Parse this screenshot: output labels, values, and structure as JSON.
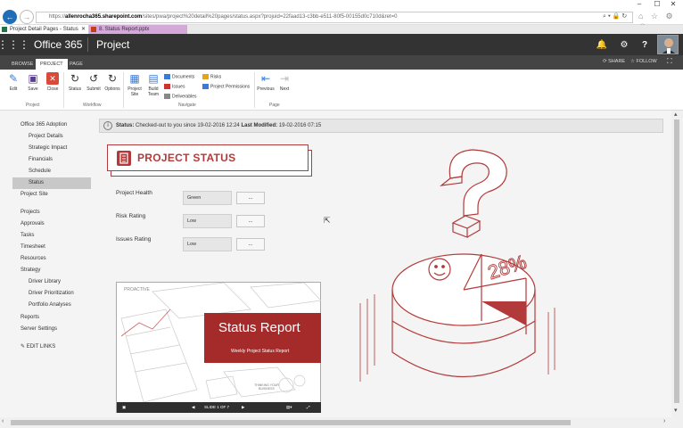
{
  "window": {
    "minimize": "–",
    "maximize": "☐",
    "close": "✕"
  },
  "browser": {
    "url_prefix": "https://",
    "url_domain": "allenrocha365.sharepoint.com",
    "url_rest": "/sites/pwa/project%20detail%20pages/status.aspx?projuid=22faad13-c3bb-e511-80f5-00155d0c710d&ret=0",
    "url_controls": "⌕ ▾ 🔒 ↻",
    "toolbar_icons": "⌂ ☆ ⚙ ☺",
    "tabs": [
      {
        "label": "Project Detail Pages - Status",
        "close": "✕"
      },
      {
        "label": "8. Status Report.pptx"
      }
    ]
  },
  "suite": {
    "app_name": "Office 365",
    "site_name": "Project",
    "bell_icon": "🔔",
    "gear_icon": "⚙",
    "help_icon": "?"
  },
  "ribbon": {
    "tabs": [
      "BROWSE",
      "PROJECT",
      "PAGE"
    ],
    "share": "SHARE",
    "follow": "FOLLOW",
    "buttons": {
      "edit": "Edit",
      "save": "Save",
      "close": "Close",
      "status": "Status",
      "submit": "Submit",
      "options": "Options",
      "project_site": "Project Site",
      "build_team": "Build Team",
      "documents": "Documents",
      "issues": "Issues",
      "deliverables": "Deliverables",
      "risks": "Risks",
      "project_permissions": "Project Permissions",
      "previous": "Previous",
      "next": "Next"
    },
    "groups": {
      "project": "Project",
      "workflow": "Workflow",
      "navigate": "Navigate",
      "page": "Page"
    }
  },
  "leftnav": {
    "items": [
      {
        "label": "Office 365 Adoption",
        "level": "top"
      },
      {
        "label": "Project Details",
        "level": "sub"
      },
      {
        "label": "Strategic Impact",
        "level": "sub"
      },
      {
        "label": "Financials",
        "level": "sub"
      },
      {
        "label": "Schedule",
        "level": "sub"
      },
      {
        "label": "Status",
        "level": "sub",
        "selected": true
      },
      {
        "label": "Project Site",
        "level": "top"
      },
      {
        "label": "Projects",
        "level": "top"
      },
      {
        "label": "Approvals",
        "level": "top"
      },
      {
        "label": "Tasks",
        "level": "top"
      },
      {
        "label": "Timesheet",
        "level": "top"
      },
      {
        "label": "Resources",
        "level": "top"
      },
      {
        "label": "Strategy",
        "level": "top"
      },
      {
        "label": "Driver Library",
        "level": "sub"
      },
      {
        "label": "Driver Prioritization",
        "level": "sub"
      },
      {
        "label": "Portfolio Analyses",
        "level": "sub"
      },
      {
        "label": "Reports",
        "level": "top"
      },
      {
        "label": "Server Settings",
        "level": "top"
      }
    ],
    "edit_links": "EDIT LINKS"
  },
  "status_bar": {
    "label": "Status:",
    "text": " Checked-out to you since 19-02-2016 12:24 ",
    "modified_label": "Last Modified:",
    "modified_value": " 19-02-2016 07:15"
  },
  "banner": {
    "title": "PROJECT STATUS"
  },
  "fields": [
    {
      "label": "Project Health",
      "value": "Green",
      "button": "..."
    },
    {
      "label": "Risk Rating",
      "value": "Low",
      "button": "..."
    },
    {
      "label": "Issues Rating",
      "value": "Low",
      "button": "..."
    }
  ],
  "slide": {
    "brand": "PROACTIVE",
    "title": "Status Report",
    "subtitle": "Weekly Project Status Report",
    "note": "THINKING YOUR BUSINESS",
    "slide_counter": "SLIDE 1 OF 7"
  },
  "illustration": {
    "percent": "28%"
  },
  "colors": {
    "accent": "#b33a3a",
    "suite": "#333333",
    "ribbon_tabs": "#444444"
  }
}
